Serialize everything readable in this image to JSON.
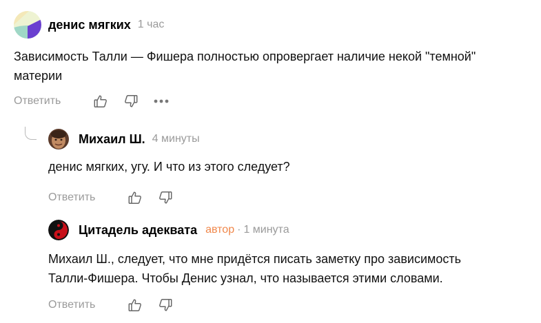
{
  "comments": [
    {
      "author": "денис мягких",
      "time": "1 час",
      "text_line1": "Зависимость Талли — Фишера полностью опровергает наличие некой \"темной\"",
      "text_line2": "материи",
      "reply_label": "Ответить",
      "avatar": "pastel-circle-avatar"
    },
    {
      "author": "Михаил Ш.",
      "time": "4 минуты",
      "text_line1": "денис мягких, угу. И что из этого следует?",
      "reply_label": "Ответить",
      "avatar": "photo-avatar"
    },
    {
      "author": "Цитадель адеквата",
      "badge": "автор",
      "separator": "·",
      "time": "1 минута",
      "text_line1": "Михаил Ш., следует, что мне придётся писать заметку про зависимость",
      "text_line2": "Талли-Фишера. Чтобы Денис узнал, что называется этими словами.",
      "reply_label": "Ответить",
      "avatar": "yin-yang-avatar"
    }
  ],
  "icons": {
    "like": "thumbs-up-icon",
    "dislike": "thumbs-down-icon",
    "more": "more-dots-icon",
    "thread": "thread-connector-icon"
  },
  "colors": {
    "author_badge": "#f0874a",
    "muted": "#9a9a9a",
    "text": "#111111"
  }
}
